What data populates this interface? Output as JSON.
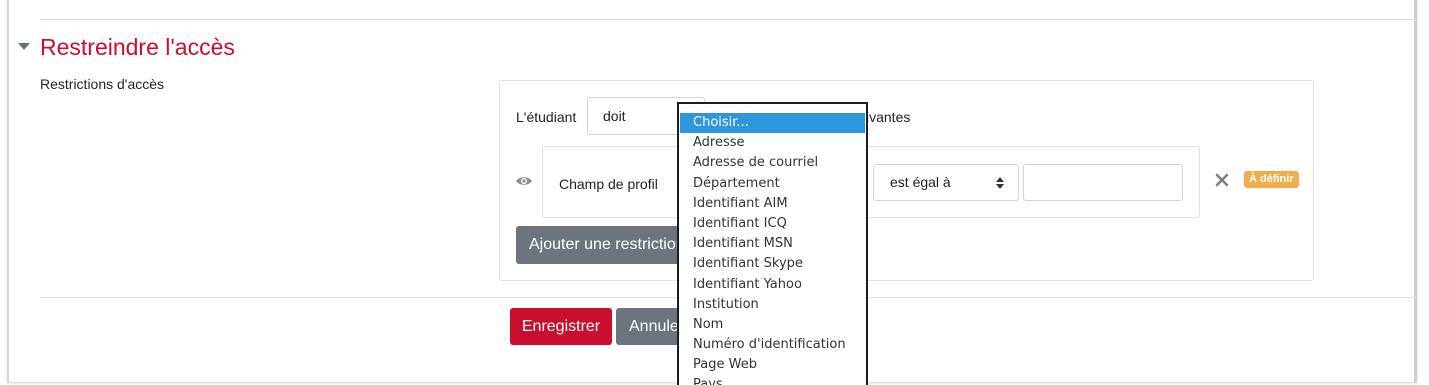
{
  "section": {
    "title": "Restreindre l'accès",
    "field_label": "Restrictions d'accès"
  },
  "restrictions": {
    "student_label": "L'étudiant",
    "must_value": "doit",
    "following_text": "ivantes",
    "condition": {
      "label": "Champ de profil",
      "operator": "est égal à",
      "value": "",
      "badge": "À définir"
    },
    "add_button": "Ajouter une restriction"
  },
  "form_buttons": {
    "save": "Enregistrer",
    "cancel": "Annuler"
  },
  "dropdown": {
    "options": [
      "Choisir...",
      "Adresse",
      "Adresse de courriel",
      "Département",
      "Identifiant AIM",
      "Identifiant ICQ",
      "Identifiant MSN",
      "Identifiant Skype",
      "Identifiant Yahoo",
      "Institution",
      "Nom",
      "Numéro d'identification",
      "Page Web",
      "Pays"
    ],
    "selected_index": 0
  },
  "colors": {
    "title_red": "#c8102e",
    "primary_button": "#c8102e",
    "secondary_button": "#6c757d",
    "badge": "#f0ad4e",
    "highlight": "#2e96dc"
  },
  "icons": {
    "caret": "chevron-down-icon",
    "eye": "eye-icon",
    "delete": "close-icon",
    "select_arrows": "sort-arrows-icon"
  }
}
